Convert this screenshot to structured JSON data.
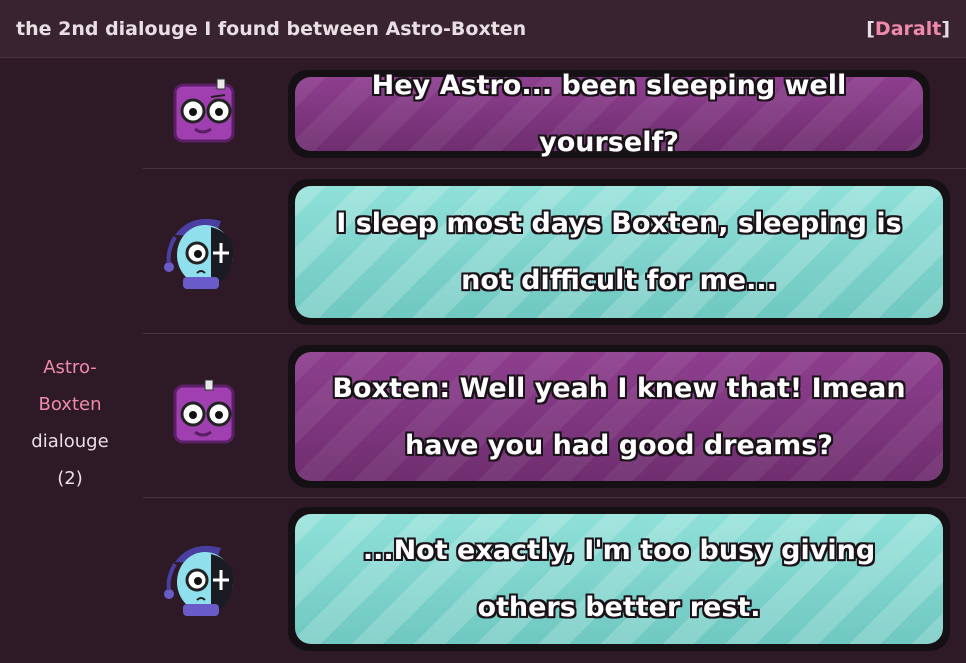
{
  "header": {
    "title": "the 2nd dialouge I found between Astro-Boxten",
    "user_open": "[",
    "user_name": "Daralt",
    "user_close": "]"
  },
  "sidebar": {
    "label_line1": "Astro-",
    "label_line2": "Boxten",
    "label_line3": "dialouge",
    "label_line4": "(2)"
  },
  "dialogue": [
    {
      "speaker": "Boxten",
      "avatar": "boxten-icon",
      "text": "Hey Astro... been sleeping well yourself?"
    },
    {
      "speaker": "Astro",
      "avatar": "astro-icon",
      "text": "I sleep most days Boxten, sleeping is not difficult for me..."
    },
    {
      "speaker": "Boxten",
      "avatar": "boxten-icon",
      "text": "Boxten: Well yeah I knew that! Imean have you had good dreams?"
    },
    {
      "speaker": "Astro",
      "avatar": "astro-icon",
      "text": "...Not exactly, I'm too busy giving others better rest."
    }
  ],
  "colors": {
    "background": "#2e1a26",
    "header": "#3a2330",
    "accent_pink": "#f08aaa",
    "bubble_purple": "#7d3680",
    "bubble_teal": "#7fd4cc"
  }
}
